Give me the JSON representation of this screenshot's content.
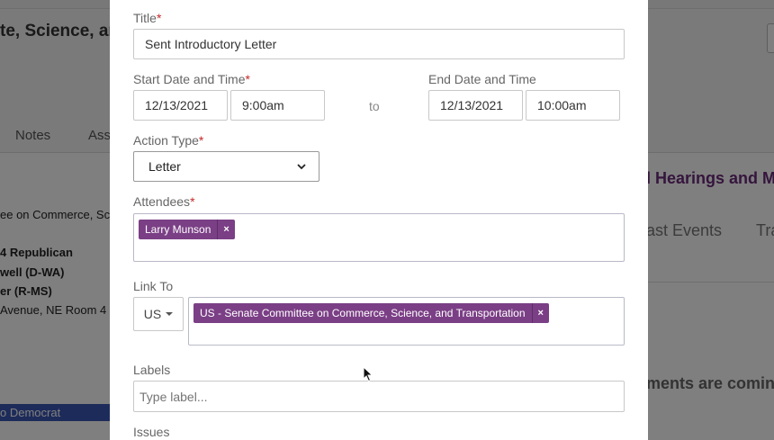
{
  "background": {
    "page_title": "te, Science, and",
    "tabs": [
      "Notes",
      "Ass"
    ],
    "lines": [
      "ee on Commerce, Sc",
      "4 Republican",
      "well (D-WA)",
      "er (R-MS)",
      " Avenue, NE Room 4"
    ],
    "right_title": "l Hearings and M",
    "right_tabs": [
      "ast Events",
      "Tra"
    ],
    "right_upcoming": "ments are comin",
    "party_badge": "o Democrat"
  },
  "form": {
    "title": {
      "label": "Title",
      "value": "Sent Introductory Letter"
    },
    "start": {
      "label": "Start Date and Time",
      "date": "12/13/2021",
      "time": "9:00am"
    },
    "to_label": "to",
    "end": {
      "label": "End Date and Time",
      "date": "12/13/2021",
      "time": "10:00am"
    },
    "action_type": {
      "label": "Action Type",
      "value": "Letter"
    },
    "attendees": {
      "label": "Attendees",
      "tags": [
        {
          "text": "Larry Munson",
          "remove": "×"
        }
      ]
    },
    "link_to": {
      "label": "Link To",
      "country": "US",
      "tags": [
        {
          "text": "US - Senate Committee on Commerce, Science, and Transportation",
          "remove": "×"
        }
      ]
    },
    "labels": {
      "label": "Labels",
      "placeholder": "Type label..."
    },
    "issues": {
      "label": "Issues"
    },
    "required_mark": "*"
  },
  "icons": {
    "dropdown": "chevron-down-icon",
    "remove": "close-icon",
    "caret": "caret-down-icon",
    "cursor": "mouse-pointer-icon"
  }
}
